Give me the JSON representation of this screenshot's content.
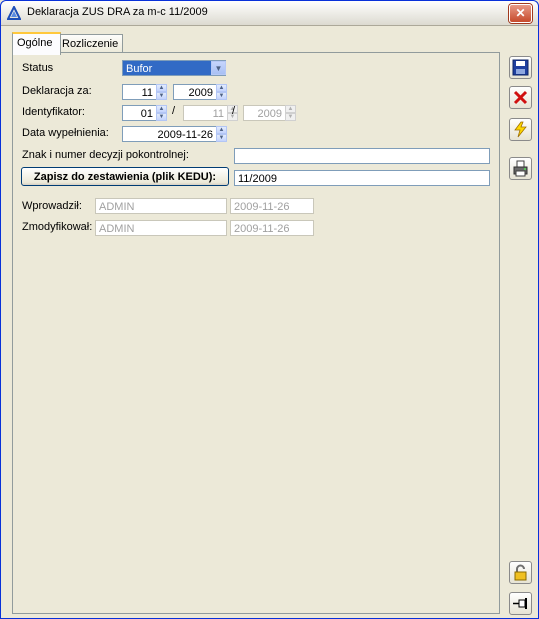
{
  "window": {
    "title": "Deklaracja ZUS DRA za m-c 11/2009"
  },
  "tabs": [
    {
      "label": "Ogólne",
      "active": true
    },
    {
      "label": "Rozliczenie",
      "active": false
    }
  ],
  "form": {
    "status": {
      "label": "Status",
      "value": "Bufor"
    },
    "deklaracja_za": {
      "label": "Deklaracja za:",
      "month": "11",
      "year": "2009"
    },
    "identyfikator": {
      "label": "Identyfikator:",
      "part1": "01",
      "sep1": "/",
      "part2": "11",
      "sep2": "/",
      "part3": "2009"
    },
    "data_wypelnienia": {
      "label": "Data wypełnienia:",
      "value": "2009-11-26"
    },
    "znak": {
      "label": "Znak i numer decyzji pokontrolnej:",
      "value": ""
    },
    "kedu": {
      "button_label": "Zapisz do zestawienia (plik KEDU):",
      "value": "11/2009"
    },
    "wprowadzil": {
      "label": "Wprowadził:",
      "user": "ADMIN",
      "date": "2009-11-26"
    },
    "zmodyfikowal": {
      "label": "Zmodyfikował:",
      "user": "ADMIN",
      "date": "2009-11-26"
    }
  },
  "colors": {
    "selection": "#316ac5",
    "border": "#7f9db9"
  },
  "icons": [
    "save-icon",
    "cancel-icon",
    "lightning-icon",
    "print-icon",
    "lock-icon",
    "pin-icon"
  ]
}
